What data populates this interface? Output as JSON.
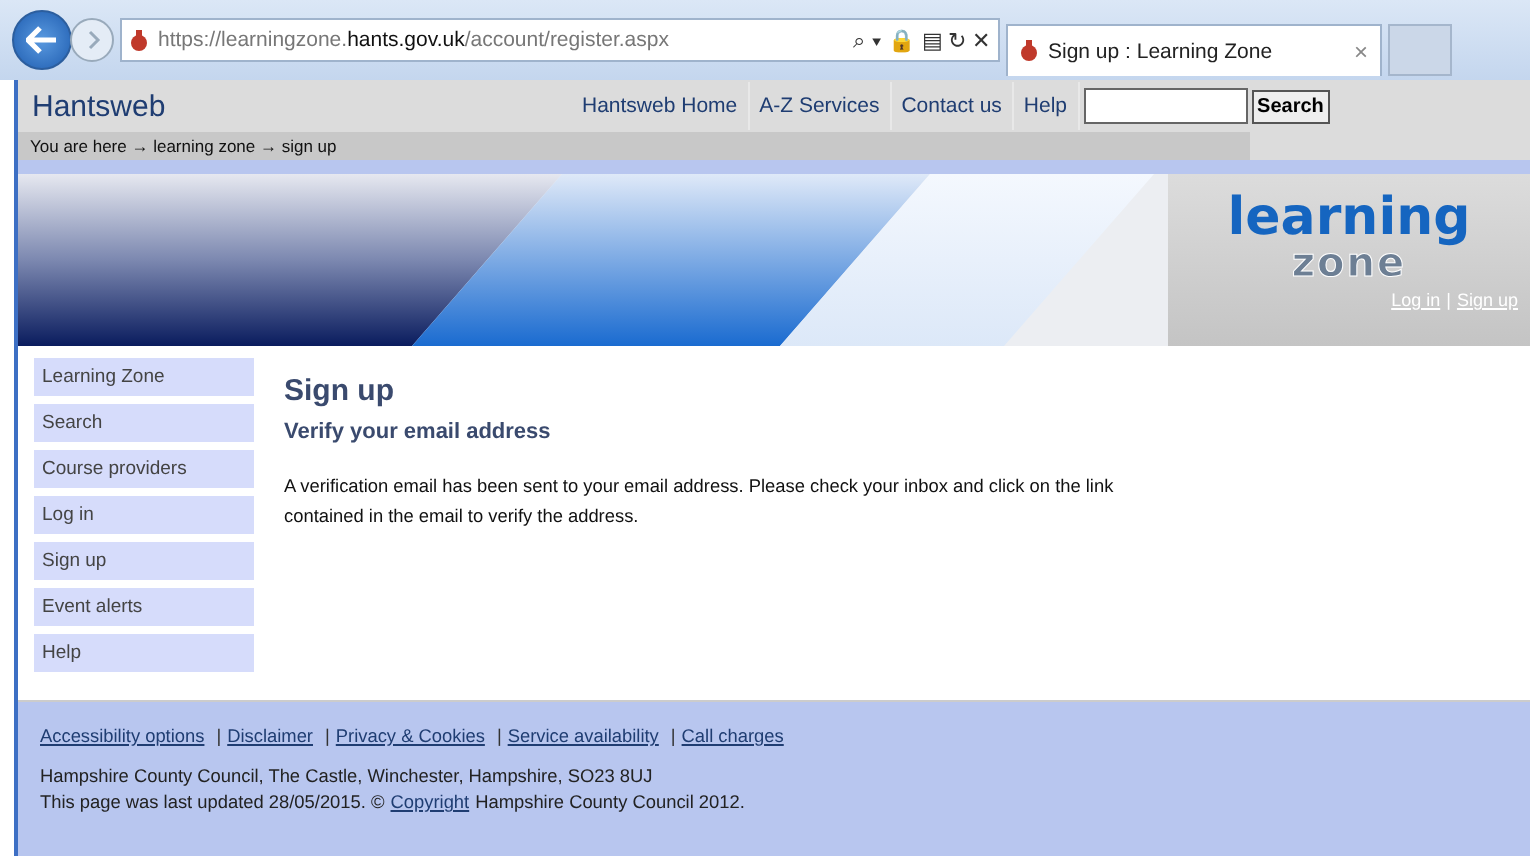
{
  "browser": {
    "url": "https://learningzone.**hants.gov.uk**/account/register.aspx",
    "url_controls": "⌕ ▾ 🔒 ▤ ↻ ✕",
    "tab_title": "Sign up : Learning Zone",
    "tab_close": "×"
  },
  "header": {
    "site_name": "Hantsweb",
    "nav": [
      "Hantsweb Home",
      "A-Z Services",
      "Contact us",
      "Help"
    ],
    "search_button": "Search",
    "breadcrumb": "You are here → learning zone → sign up"
  },
  "banner": {
    "logo_top": "learning",
    "logo_bottom": "zone",
    "links": [
      "Log in",
      "Sign up"
    ],
    "separator": "|"
  },
  "sidebar": {
    "items": [
      "Learning Zone",
      "Search",
      "Course providers",
      "Log in",
      "Sign up",
      "Event alerts",
      "Help"
    ]
  },
  "content": {
    "title": "Sign up",
    "subtitle": "Verify your email address",
    "message": "A verification email has been sent to your email address. Please check your inbox and click on the link contained in the email to verify the address."
  },
  "footer": {
    "links": [
      "Accessibility options",
      "Disclaimer",
      "Privacy & Cookies",
      "Service availability",
      "Call charges"
    ],
    "separator": "|",
    "address": "Hampshire County Council, The Castle, Winchester, Hampshire, SO23 8UJ",
    "updated_before": "This page was last updated 28/05/2015. ©",
    "copyright_link": "Copyright",
    "updated_after": "Hampshire County Council 2012."
  }
}
